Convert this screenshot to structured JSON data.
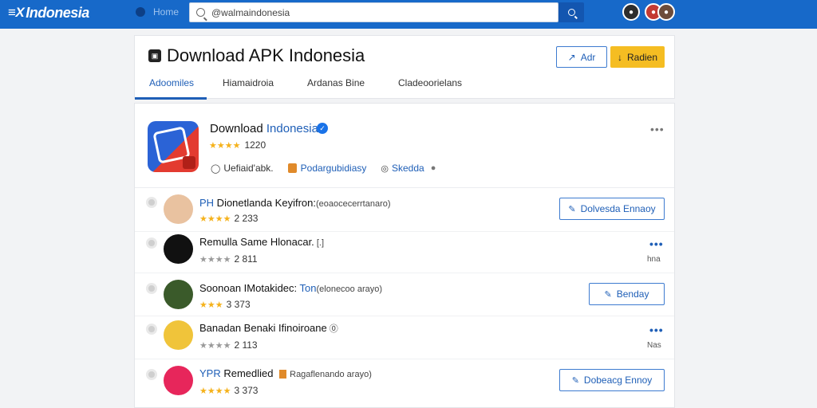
{
  "topbar": {
    "logo_mark": "≡X",
    "logo_text": "Indonesia",
    "home_label": "Home",
    "search_value": "@walmaindonesia"
  },
  "header": {
    "title": "Download APK Indonesia",
    "btn_outline": "Adr",
    "btn_yellow": "Radien",
    "tabs": [
      {
        "label": "Adoomiles",
        "active": true
      },
      {
        "label": "Hiamaidroia",
        "active": false
      },
      {
        "label": "Ardanas Bine",
        "active": false
      },
      {
        "label": "Cladeoorielans",
        "active": false
      }
    ]
  },
  "app": {
    "name_prefix": "Download ",
    "name_highlight": "Indonesia",
    "rating_stars": "★★★★",
    "rating_count": "1220",
    "meta1": "Uefiaid'abk.",
    "meta2": "Podargubidiasy",
    "meta3": "Skedda",
    "more": "•••"
  },
  "rows": [
    {
      "title_prefix": "PH",
      "title": " Dionetlanda Keyifron:",
      "title_suffix": "(eoaocecerrtanaro)",
      "stars_on": "★★★★",
      "stars_off": "",
      "count": "2 233",
      "button": "Dolvesda Ennaoy",
      "thumb_bg": "#e9c2a0"
    },
    {
      "title_prefix": "",
      "title": "Remulla Same Hlonacar.",
      "title_suffix": "  [.]",
      "stars_on": "",
      "stars_off": "★★★★",
      "count": "2 811",
      "more": "•••",
      "meta": "hna",
      "thumb_bg": "#111111"
    },
    {
      "title_prefix": "",
      "title": "Soonoan IMotakidec: ",
      "title_blue": "Ton",
      "title_suffix": "(elonecoo arayo)",
      "stars_on": "★★★",
      "stars_off": "",
      "count": "3 373",
      "button": "Benday",
      "thumb_bg": "#3a5a2a"
    },
    {
      "title_prefix": "",
      "title": "Banadan Benaki Ifinoiroane",
      "title_suffix": " ⓪",
      "stars_on": "",
      "stars_off": "★★★★",
      "count": "2 113",
      "more": "•••",
      "meta": "Nas",
      "thumb_bg": "#f0c43a"
    },
    {
      "title_prefix": "YPR",
      "title": " Remedlied",
      "title_suffix": "Ragaflenando arayo)",
      "stars_on": "★★★★",
      "stars_off": "",
      "count": "3 373",
      "button": "Dobeacg Ennoy",
      "thumb_bg": "#e7265b"
    }
  ]
}
